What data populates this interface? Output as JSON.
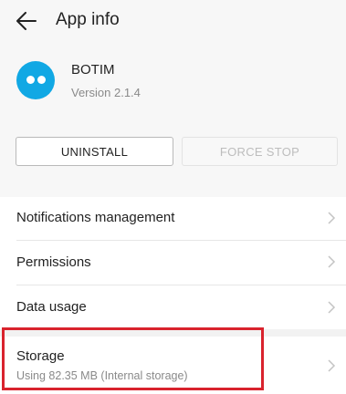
{
  "header": {
    "title": "App info",
    "back_icon": "back-arrow-icon"
  },
  "app": {
    "name": "BOTIM",
    "version": "Version 2.1.4",
    "icon": "botim-app-icon",
    "icon_color": "#11a8e4"
  },
  "actions": {
    "uninstall_label": "UNINSTALL",
    "force_stop_label": "FORCE STOP",
    "force_stop_enabled": false
  },
  "settings": {
    "notifications_label": "Notifications management",
    "permissions_label": "Permissions",
    "data_usage_label": "Data usage",
    "storage_label": "Storage",
    "storage_detail": "Using 82.35 MB (Internal storage)"
  },
  "highlight": {
    "target": "storage",
    "color": "#d9232d"
  }
}
